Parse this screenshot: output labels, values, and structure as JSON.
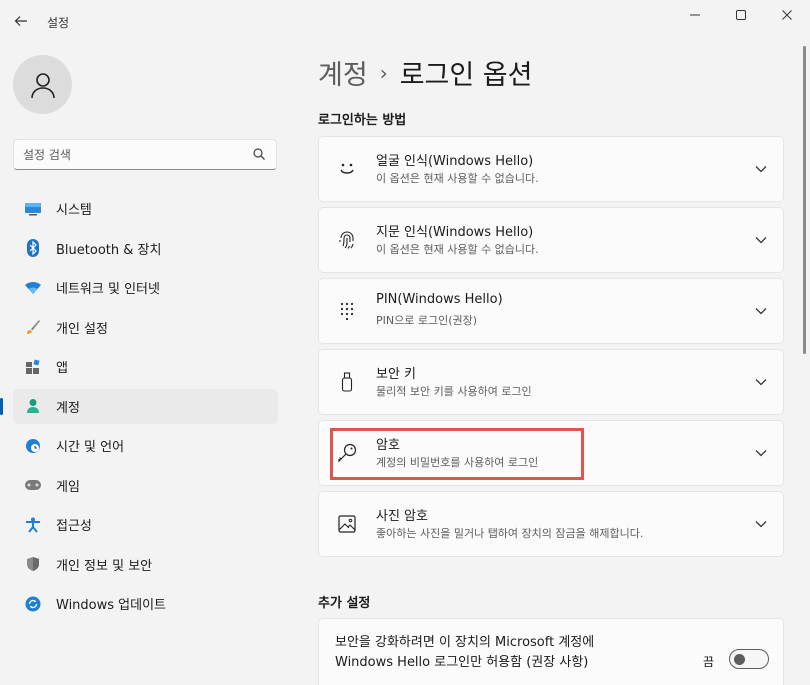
{
  "window": {
    "title": "설정",
    "minimize_glyph": "—",
    "maximize_glyph": "☐",
    "close_glyph": "✕"
  },
  "search": {
    "placeholder": "설정 검색"
  },
  "nav": {
    "items": [
      {
        "label": "시스템",
        "icon": "monitor-icon"
      },
      {
        "label": "Bluetooth & 장치",
        "icon": "bluetooth-icon"
      },
      {
        "label": "네트워크 및 인터넷",
        "icon": "wifi-icon"
      },
      {
        "label": "개인 설정",
        "icon": "brush-icon"
      },
      {
        "label": "앱",
        "icon": "apps-icon"
      },
      {
        "label": "계정",
        "icon": "person-icon",
        "selected": true
      },
      {
        "label": "시간 및 언어",
        "icon": "globe-clock-icon"
      },
      {
        "label": "게임",
        "icon": "gamepad-icon"
      },
      {
        "label": "접근성",
        "icon": "accessibility-icon"
      },
      {
        "label": "개인 정보 및 보안",
        "icon": "shield-icon"
      },
      {
        "label": "Windows 업데이트",
        "icon": "update-icon"
      }
    ]
  },
  "breadcrumb": {
    "parent": "계정",
    "separator": "›",
    "current": "로그인 옵션"
  },
  "signin": {
    "section_title": "로그인하는 방법",
    "options": [
      {
        "title": "얼굴 인식(Windows Hello)",
        "subtitle": "이 옵션은 현재 사용할 수 없습니다.",
        "icon": "face-icon"
      },
      {
        "title": "지문 인식(Windows Hello)",
        "subtitle": "이 옵션은 현재 사용할 수 없습니다.",
        "icon": "fingerprint-icon"
      },
      {
        "title": "PIN(Windows Hello)",
        "subtitle": "PIN으로 로그인(권장)",
        "icon": "keypad-icon"
      },
      {
        "title": "보안 키",
        "subtitle": "물리적 보안 키를 사용하여 로그인",
        "icon": "usb-key-icon"
      },
      {
        "title": "암호",
        "subtitle": "계정의 비밀번호를 사용하여 로그인",
        "icon": "key-icon",
        "highlighted": true
      },
      {
        "title": "사진 암호",
        "subtitle": "좋아하는 사진을 밀거나 탭하여 장치의 잠금을 해제합니다.",
        "icon": "picture-icon"
      }
    ]
  },
  "extra": {
    "section_title": "추가 설정",
    "setting_text": "보안을 강화하려면 이 장치의 Microsoft 계정에 Windows Hello 로그인만 허용함 (권장 사항)",
    "toggle_label": "끔",
    "toggle_on": false
  },
  "colors": {
    "accent": "#005fb8",
    "highlight_border": "#e0544a"
  }
}
